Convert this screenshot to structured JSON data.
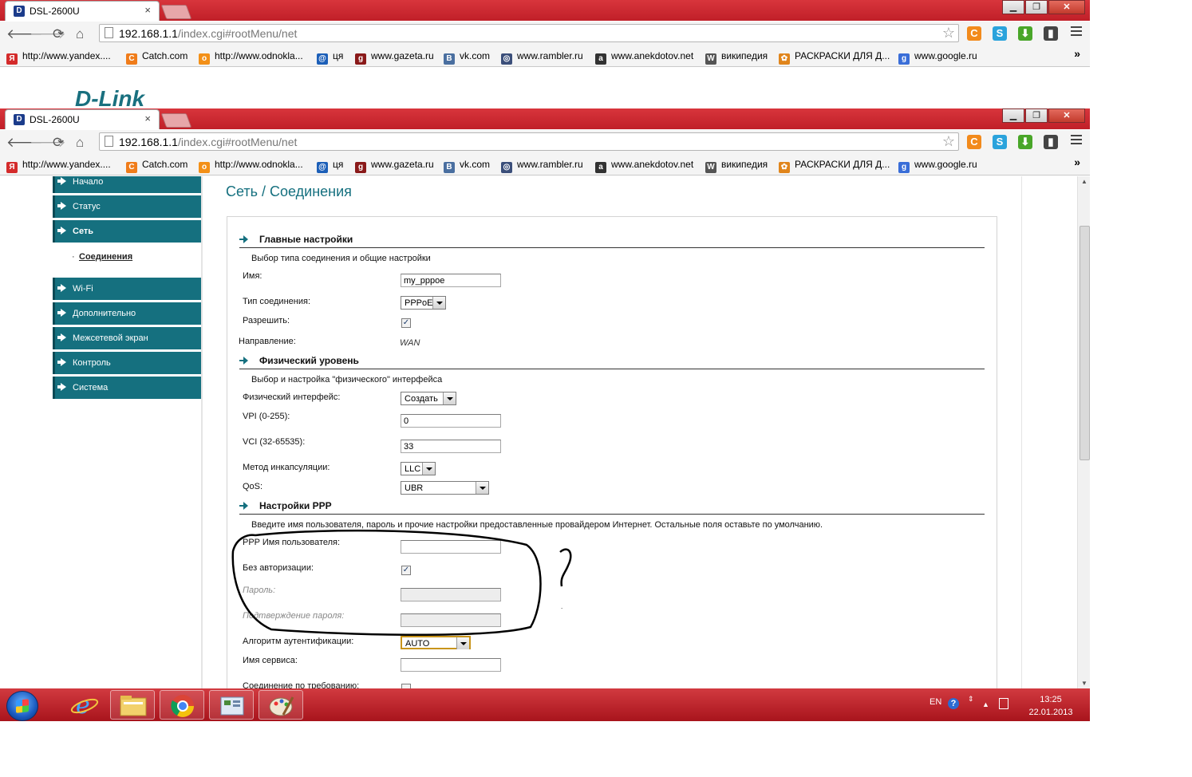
{
  "browser": {
    "tab_title": "DSL-2600U",
    "tab_close": "×",
    "url_host": "192.168.1.1",
    "url_rest": "/index.cgi#rootMenu/net",
    "bookmarks": [
      {
        "label": "http://www.yandex....",
        "icon": "yandex-icon",
        "glyph": "Я",
        "color": "#d42b2b"
      },
      {
        "label": "Catch.com",
        "icon": "catch-icon",
        "glyph": "C",
        "color": "#f07c1a"
      },
      {
        "label": "http://www.odnokla...",
        "icon": "odnoklassniki-icon",
        "glyph": "о",
        "color": "#f39018"
      },
      {
        "label": "ця",
        "icon": "mail-at-icon",
        "glyph": "@",
        "color": "#1c5fb8"
      },
      {
        "label": "www.gazeta.ru",
        "icon": "gazeta-icon",
        "glyph": "g",
        "color": "#8a1a1a"
      },
      {
        "label": "vk.com",
        "icon": "vk-icon",
        "glyph": "B",
        "color": "#4a6fa0"
      },
      {
        "label": "www.rambler.ru",
        "icon": "rambler-icon",
        "glyph": "◎",
        "color": "#3b4f7a"
      },
      {
        "label": "www.anekdotov.net",
        "icon": "anekdotov-icon",
        "glyph": "a",
        "color": "#333333"
      },
      {
        "label": "википедия",
        "icon": "wikipedia-icon",
        "glyph": "W",
        "color": "#555555"
      },
      {
        "label": "РАСКРАСКИ ДЛЯ Д...",
        "icon": "raskraski-icon",
        "glyph": "✿",
        "color": "#e0851c"
      },
      {
        "label": "www.google.ru",
        "icon": "google-icon",
        "glyph": "g",
        "color": "#3a6ed8"
      }
    ],
    "more": "»"
  },
  "back_window": {
    "logo": "D-Link"
  },
  "sidebar": {
    "items": [
      {
        "label": "Начало"
      },
      {
        "label": "Статус"
      },
      {
        "label": "Сеть"
      },
      {
        "label": "Wi-Fi"
      },
      {
        "label": "Дополнительно"
      },
      {
        "label": "Межсетевой экран"
      },
      {
        "label": "Контроль"
      },
      {
        "label": "Система"
      }
    ],
    "subitem": "Соединения",
    "subitem_bullet": "·"
  },
  "page": {
    "title": "Сеть / Соединения",
    "main_settings": {
      "heading": "Главные настройки",
      "desc": "Выбор типа соединения и общие настройки",
      "name_label": "Имя:",
      "name_value": "my_pppoe",
      "conn_type_label": "Тип соединения:",
      "conn_type_value": "PPPoE",
      "enable_label": "Разрешить:",
      "direction_label": "Направление:",
      "direction_value": "WAN"
    },
    "physical": {
      "heading": "Физический уровень",
      "desc": "Выбор и настройка \"физического\" интерфейса",
      "iface_label": "Физический интерфейс:",
      "iface_value": "Создать",
      "vpi_label": "VPI (0-255):",
      "vpi_value": "0",
      "vci_label": "VCI (32-65535):",
      "vci_value": "33",
      "encap_label": "Метод инкапсуляции:",
      "encap_value": "LLC",
      "qos_label": "QoS:",
      "qos_value": "UBR"
    },
    "ppp": {
      "heading": "Настройки PPP",
      "desc": "Введите имя пользователя, пароль и прочие настройки предоставленные провайдером Интернет. Остальные поля оставьте по умолчанию.",
      "user_label": "PPP Имя пользователя:",
      "user_value": "",
      "noauth_label": "Без авторизации:",
      "password_label": "Пароль:",
      "confirm_label": "Подтверждение пароля:",
      "auth_label": "Алгоритм аутентификации:",
      "auth_value": "AUTO",
      "service_label": "Имя сервиса:",
      "ondemand_label": "Соединение по требованию:"
    },
    "annotation": "?"
  },
  "taskbar": {
    "lang": "EN",
    "time": "13:25",
    "date": "22.01.2013"
  },
  "colors": {
    "accent": "#15707f",
    "titlebar": "#c9232c",
    "annotation_ink": "#000000"
  }
}
